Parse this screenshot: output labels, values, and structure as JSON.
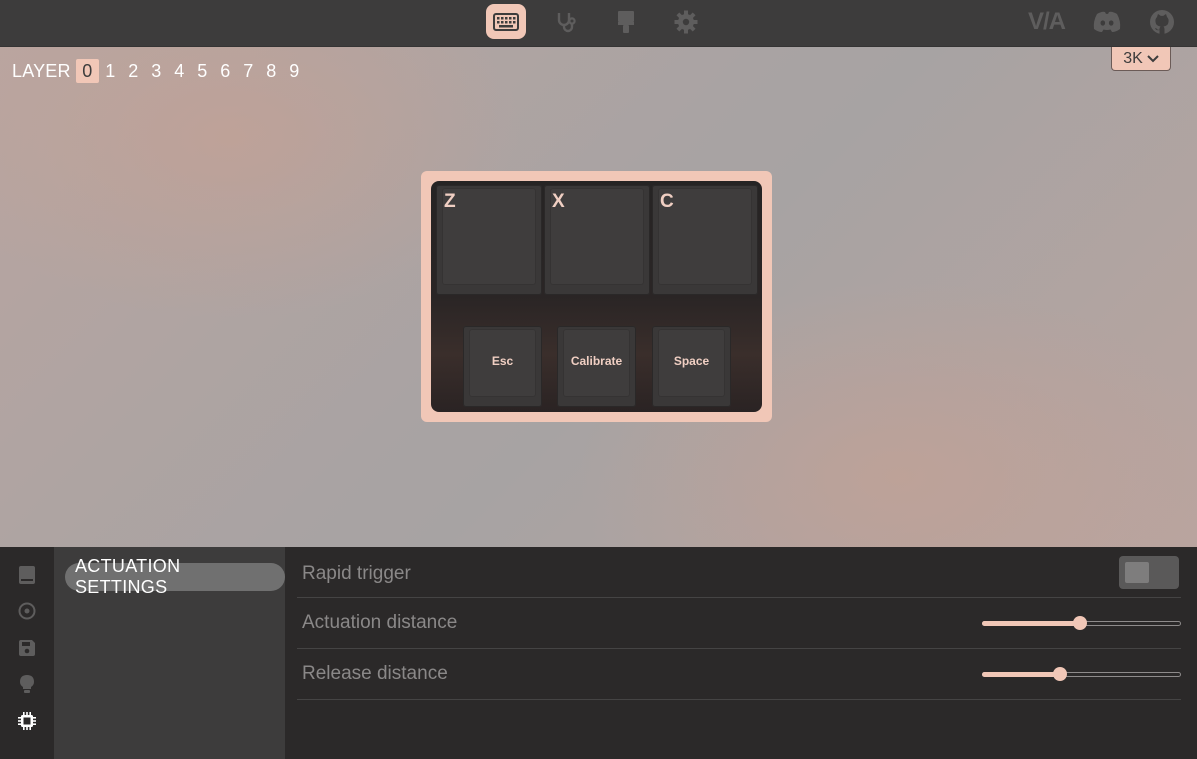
{
  "topbar": {
    "tabs": [
      {
        "icon": "keyboard-icon",
        "active": true
      },
      {
        "icon": "stethoscope-icon",
        "active": false
      },
      {
        "icon": "paintbrush-icon",
        "active": false
      },
      {
        "icon": "gear-icon",
        "active": false
      }
    ],
    "right_links": [
      {
        "icon": "via-logo-icon",
        "text": "V/A"
      },
      {
        "icon": "discord-icon"
      },
      {
        "icon": "github-icon"
      }
    ]
  },
  "keyboard": {
    "layer_label": "LAYER",
    "layers": [
      "0",
      "1",
      "2",
      "3",
      "4",
      "5",
      "6",
      "7",
      "8",
      "9"
    ],
    "active_layer": "0",
    "layout_select": "3K",
    "top_keys": [
      "Z",
      "X",
      "C"
    ],
    "bottom_keys": [
      "Esc",
      "Calibrate",
      "Space"
    ]
  },
  "sidebar": {
    "icons": [
      "book-icon",
      "circle-target-icon",
      "save-icon",
      "lightbulb-icon",
      "chip-icon"
    ],
    "active_icon": "chip-icon"
  },
  "menu": {
    "active_item": "ACTUATION SETTINGS"
  },
  "settings": {
    "rapid_trigger": {
      "label": "Rapid trigger",
      "enabled": false
    },
    "actuation_distance": {
      "label": "Actuation distance",
      "level": 0.49
    },
    "release_distance": {
      "label": "Release distance",
      "level": 0.39
    }
  },
  "colors": {
    "accent": "#f1c7b7",
    "topbar_bg": "#3d3c3c",
    "panel_bg": "#2b2929"
  }
}
